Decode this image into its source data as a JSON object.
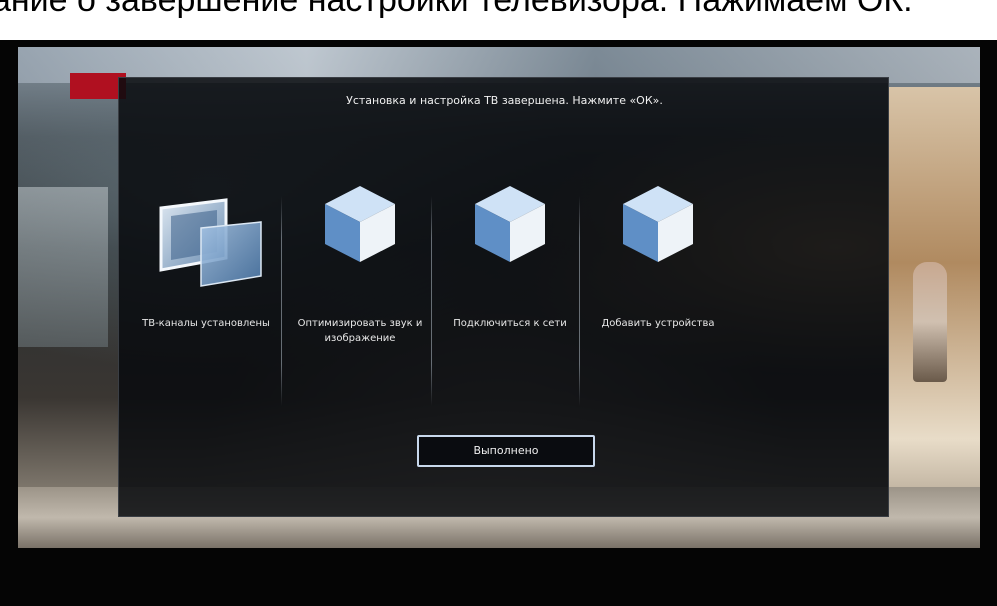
{
  "caption": {
    "text": "ание о завершение настройки телевизора. Нажимаем ОК."
  },
  "dialog": {
    "title": "Установка и настройка ТВ завершена. Нажмите «ОК».",
    "options": [
      {
        "icon": "screens-icon",
        "label": "ТВ-каналы установлены"
      },
      {
        "icon": "cube-icon",
        "label": "Оптимизировать звук и изображение"
      },
      {
        "icon": "cube-icon",
        "label": "Подключиться к сети"
      },
      {
        "icon": "cube-icon",
        "label": "Добавить устройства"
      }
    ],
    "done_button": "Выполнено"
  },
  "colors": {
    "dialog_bg": "#080a0e",
    "cube_top": "#cfe2f6",
    "cube_left": "#5f8fc6",
    "cube_right": "#eef3f8",
    "button_border": "#c8d8ec"
  }
}
